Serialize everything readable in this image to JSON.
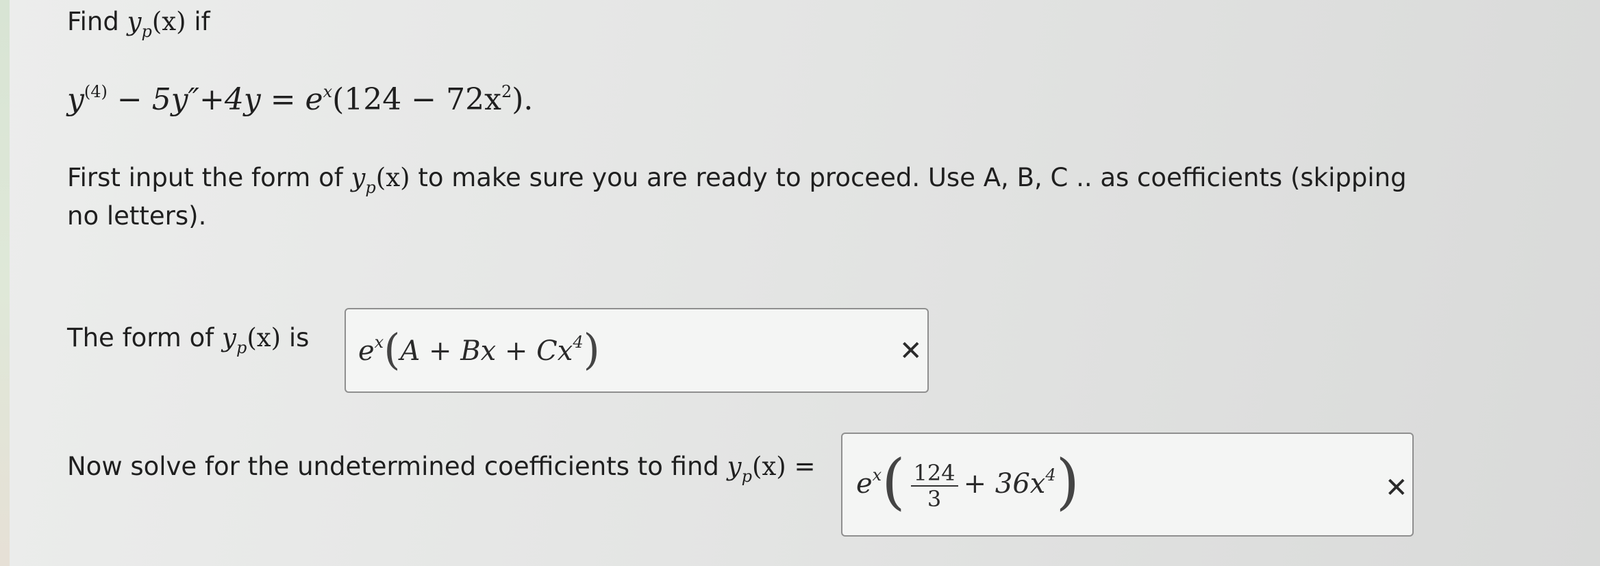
{
  "header": {
    "find_word": "Find",
    "y_letter": "y",
    "sub_p": "p",
    "of_x": "(x)",
    "if_word": "if"
  },
  "equation": {
    "y1": "y",
    "sup4": "(4)",
    "part1": " − 5y″+4y = e",
    "supx": "x",
    "part2": "(124 − 72x",
    "sup2": "2",
    "part3": ")."
  },
  "instruction": {
    "text_before": "First input the form of",
    "y_letter": "y",
    "sub_p": "p",
    "of_x": "(x)",
    "text_after": "to make sure you are ready to proceed. Use A, B, C .. as coefficients (skipping",
    "line2": "no letters)."
  },
  "form_question": {
    "label_before": "The form of",
    "y_letter": "y",
    "sub_p": "p",
    "of_x": "(x)",
    "label_after": "is",
    "answer": {
      "e": "e",
      "supx": "x",
      "open": "(",
      "body": "A + Bx + Cx",
      "sup4": "4",
      "close": ")"
    },
    "close_icon": "✕"
  },
  "solve_question": {
    "label_before": "Now solve for the undetermined coefficients to find",
    "y_letter": "y",
    "sub_p": "p",
    "of_x": "(x)",
    "equals": "=",
    "answer": {
      "e": "e",
      "supx": "x",
      "open": "(",
      "frac_num": "124",
      "frac_den": "3",
      "plus_term": "+ 36x",
      "sup4": "4",
      "close": ")"
    },
    "close_icon": "✕"
  }
}
